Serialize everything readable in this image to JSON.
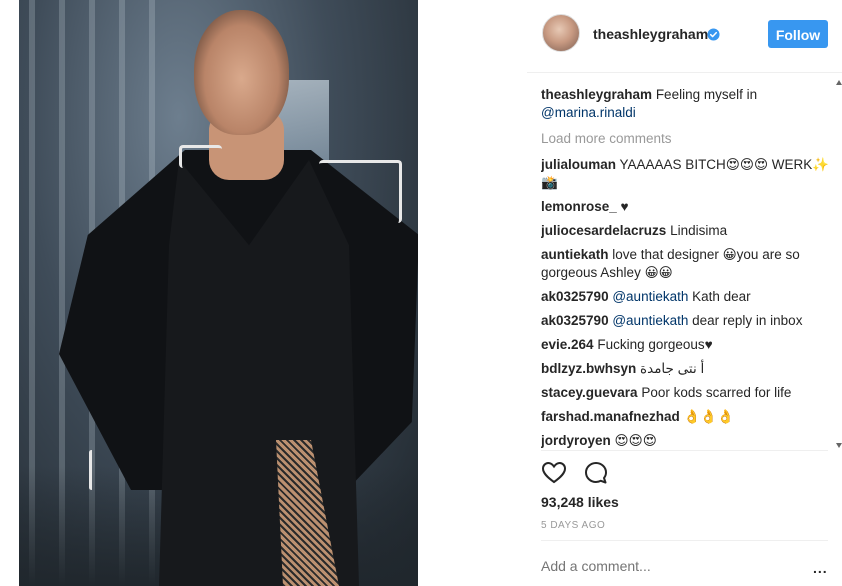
{
  "post": {
    "username": "theashleygraham",
    "follow_label": "Follow",
    "caption": {
      "user": "theashleygraham",
      "text": "Feeling myself in",
      "mention": "@marina.rinaldi"
    },
    "load_more": "Load more comments",
    "comments": [
      {
        "user": "julialouman",
        "text": "YAAAAAS BITCH😍😍😍 WERK✨📸"
      },
      {
        "user": "lemonrose_",
        "text": "♥"
      },
      {
        "user": "juliocesardelacruzs",
        "text": "Lindisima"
      },
      {
        "user": "auntiekath",
        "text": "love that designer 😀you are so gorgeous Ashley 😀😀"
      },
      {
        "user": "ak0325790",
        "mention": "@auntiekath",
        "text": "Kath dear"
      },
      {
        "user": "ak0325790",
        "mention": "@auntiekath",
        "text": "dear reply in inbox"
      },
      {
        "user": "evie.264",
        "text": "Fucking gorgeous♥"
      },
      {
        "user": "bdlzyz.bwhsyn",
        "text": "أ نتى جامدة"
      },
      {
        "user": "stacey.guevara",
        "text": "Poor kods scarred for life"
      },
      {
        "user": "farshad.manafnezhad",
        "text": "👌👌👌"
      },
      {
        "user": "jordyroyen",
        "text": "😍😍😍"
      }
    ],
    "likes": "93,248 likes",
    "time": "5 DAYS AGO",
    "add_comment_placeholder": "Add a comment...",
    "more_label": "..."
  },
  "icons": {
    "verified": "verified-badge-icon",
    "heart": "heart-icon",
    "comment": "comment-icon"
  },
  "colors": {
    "follow": "#3897f0",
    "verified": "#3897f0",
    "muted": "#999999",
    "mention": "#003569"
  }
}
